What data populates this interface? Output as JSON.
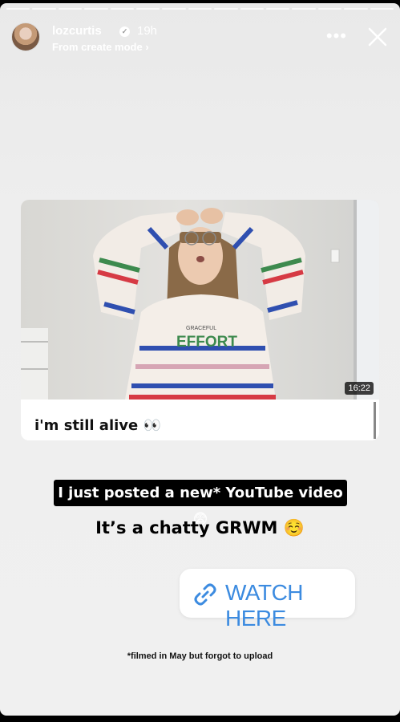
{
  "header": {
    "username": "lozcurtis",
    "time": "19h",
    "subline": "From create mode ›",
    "more_label": "•••"
  },
  "card": {
    "title": "i'm still alive 👀",
    "duration": "16:22",
    "sweater_text": "EFFORT",
    "sweater_small": "GRACEFUL"
  },
  "caption1": "I just posted a new* YouTube video 😨",
  "caption2": "It’s a chatty GRWM ☺️",
  "link": {
    "label": "WATCH HERE"
  },
  "footnote": "*filmed in May but forgot to upload",
  "colors": {
    "link": "#3c8be0",
    "stripe_red": "#d63a44",
    "stripe_blue": "#2f4fb0",
    "stripe_green": "#3d8a4e"
  }
}
